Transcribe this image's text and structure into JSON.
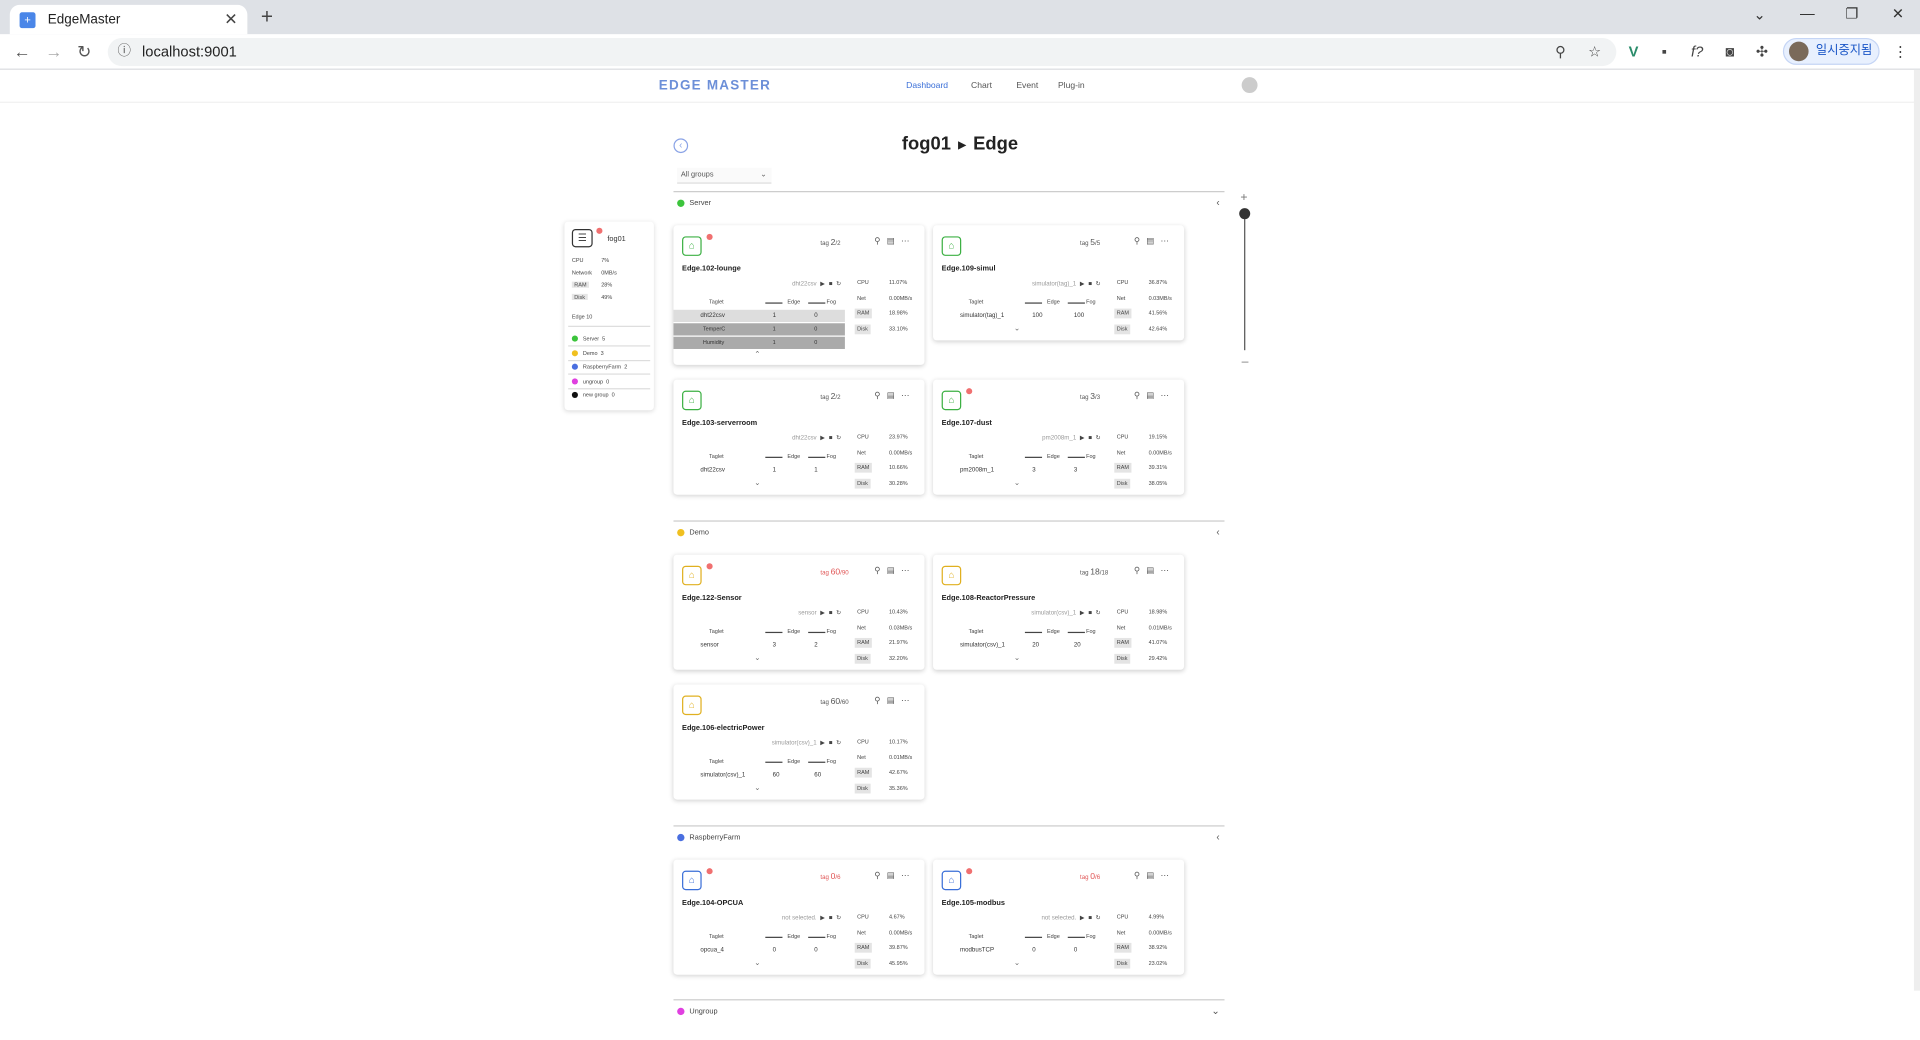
{
  "browser": {
    "tab_title": "EdgeMaster",
    "url": "localhost:9001",
    "profile_name": "일시중지됨"
  },
  "app": {
    "logo": "EDGE MASTER",
    "nav": [
      "Dashboard",
      "Chart",
      "Event",
      "Plug-in"
    ],
    "active_nav": "Dashboard"
  },
  "page": {
    "title_fog": "fog01",
    "title_edge": "Edge",
    "group_select": "All groups"
  },
  "fog": {
    "name": "fog01",
    "cpu_label": "CPU",
    "cpu": "7%",
    "network_label": "Network",
    "network": "0MB/s",
    "ram_label": "RAM",
    "ram": "28%",
    "disk_label": "Disk",
    "disk": "49%",
    "edge_count": "Edge 10",
    "groups": [
      {
        "name": "Server",
        "count": "5",
        "color": "#3cc43c"
      },
      {
        "name": "Demo",
        "count": "3",
        "color": "#f0c020"
      },
      {
        "name": "RaspberryFarm",
        "count": "2",
        "color": "#4a6fe0"
      },
      {
        "name": "ungroup",
        "count": "0",
        "color": "#e040e0"
      },
      {
        "name": "new group",
        "count": "0",
        "color": "#111111"
      }
    ]
  },
  "labels": {
    "taglet": "Taglet",
    "edge": "Edge",
    "fog": "Fog",
    "cpu": "CPU",
    "net": "Net",
    "ram": "RAM",
    "disk": "Disk",
    "tag": "tag"
  },
  "sections": [
    {
      "name": "Server",
      "color": "#3cc43c",
      "cards": [
        {
          "name": "Edge.102-lounge",
          "tag_now": "2",
          "tag_total": "/2",
          "ctrl": "dht22csv",
          "rows": [
            [
              "dht22csv",
              "1",
              "0"
            ]
          ],
          "sub_rows": [
            [
              "TemperC",
              "1",
              "0"
            ],
            [
              "Humidity",
              "1",
              "0"
            ]
          ],
          "cpu": "11.07%",
          "net": "0.00MB/s",
          "ram": "18.98%",
          "disk": "33.10%"
        },
        {
          "name": "Edge.109-simul",
          "tag_now": "5",
          "tag_total": "/5",
          "ctrl": "simulator(tag)_1",
          "rows": [
            [
              "simulator(tag)_1",
              "100",
              "100"
            ]
          ],
          "cpu": "36.87%",
          "net": "0.03MB/s",
          "ram": "41.56%",
          "disk": "42.64%"
        },
        {
          "name": "Edge.103-serverroom",
          "tag_now": "2",
          "tag_total": "/2",
          "ctrl": "dht22csv",
          "rows": [
            [
              "dht22csv",
              "1",
              "1"
            ]
          ],
          "cpu": "23.97%",
          "net": "0.00MB/s",
          "ram": "10.66%",
          "disk": "30.28%"
        },
        {
          "name": "Edge.107-dust",
          "tag_now": "3",
          "tag_total": "/3",
          "ctrl": "pm2008m_1",
          "rows": [
            [
              "pm2008m_1",
              "3",
              "3"
            ]
          ],
          "cpu": "19.15%",
          "net": "0.00MB/s",
          "ram": "39.31%",
          "disk": "38.05%"
        }
      ]
    },
    {
      "name": "Demo",
      "color": "#f0c020",
      "cards": [
        {
          "name": "Edge.122-Sensor",
          "tag_now": "60",
          "tag_total": "/90",
          "ctrl": "sensor",
          "rows": [
            [
              "sensor",
              "3",
              "2"
            ]
          ],
          "cpu": "10.43%",
          "net": "0.03MB/s",
          "ram": "21.97%",
          "disk": "32.20%"
        },
        {
          "name": "Edge.108-ReactorPressure",
          "tag_now": "18",
          "tag_total": "/18",
          "ctrl": "simulator(csv)_1",
          "rows": [
            [
              "simulator(csv)_1",
              "20",
              "20"
            ]
          ],
          "cpu": "18.98%",
          "net": "0.01MB/s",
          "ram": "41.07%",
          "disk": "29.42%"
        },
        {
          "name": "Edge.106-electricPower",
          "tag_now": "60",
          "tag_total": "/60",
          "ctrl": "simulator(csv)_1",
          "rows": [
            [
              "simulator(csv)_1",
              "60",
              "60"
            ]
          ],
          "cpu": "10.17%",
          "net": "0.01MB/s",
          "ram": "42.67%",
          "disk": "35.36%"
        }
      ]
    },
    {
      "name": "RaspberryFarm",
      "color": "#4a6fe0",
      "cards": [
        {
          "name": "Edge.104-OPCUA",
          "tag_now": "0",
          "tag_total": "/6",
          "ctrl": "not selected.",
          "rows": [
            [
              "opcua_4",
              "0",
              "0"
            ]
          ],
          "cpu": "4.67%",
          "net": "0.00MB/s",
          "ram": "39.87%",
          "disk": "45.95%"
        },
        {
          "name": "Edge.105-modbus",
          "tag_now": "0",
          "tag_total": "/6",
          "ctrl": "not selected.",
          "rows": [
            [
              "modbusTCP",
              "0",
              "0"
            ]
          ],
          "cpu": "4.99%",
          "net": "0.00MB/s",
          "ram": "38.92%",
          "disk": "23.02%"
        }
      ]
    },
    {
      "name": "Ungroup",
      "color": "#e040e0",
      "cards": []
    }
  ]
}
